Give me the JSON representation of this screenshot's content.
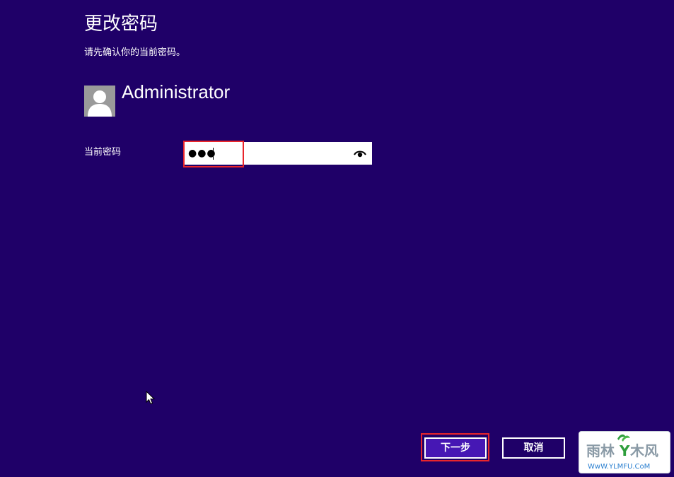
{
  "header": {
    "title": "更改密码",
    "subtitle": "请先确认你的当前密码。"
  },
  "account": {
    "avatar_icon": "user-silhouette-icon",
    "username": "Administrator"
  },
  "password": {
    "label": "当前密码",
    "masked_value": "●●●",
    "reveal_icon": "eye-icon"
  },
  "actions": {
    "next_label": "下一步",
    "cancel_label": "取消"
  },
  "watermark": {
    "logo_text": "雨林木风",
    "url_text": "WwW.YLMFU.CoM"
  },
  "colors": {
    "background": "#1f0068",
    "primary_button": "#4617b4",
    "highlight_box": "#e8252b"
  }
}
